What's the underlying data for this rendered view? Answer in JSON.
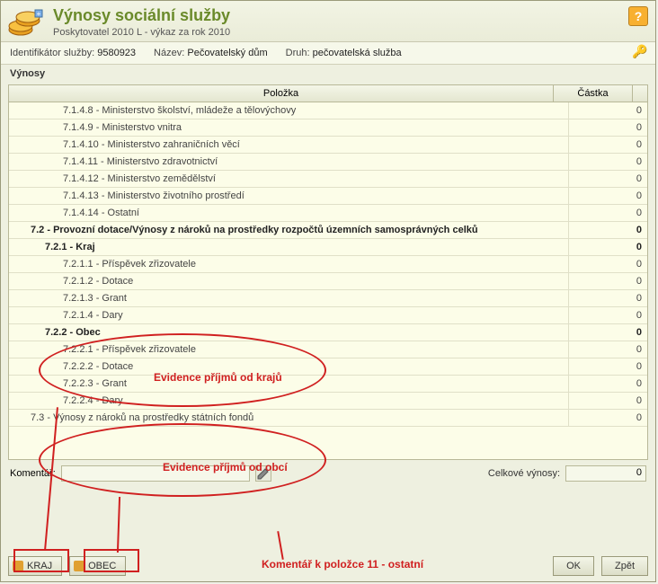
{
  "header": {
    "title": "Výnosy sociální služby",
    "subtitle": "Poskytovatel 2010 L - výkaz za rok 2010"
  },
  "info": {
    "id_label": "Identifikátor služby:",
    "id_value": "9580923",
    "name_label": "Název:",
    "name_value": "Pečovatelský dům",
    "type_label": "Druh:",
    "type_value": "pečovatelská služba"
  },
  "section": "Výnosy",
  "columns": {
    "name": "Položka",
    "amount": "Částka"
  },
  "rows": [
    {
      "label": "7.1.4.8 - Ministerstvo školství, mládeže a tělovýchovy",
      "amt": "0",
      "indent": 3
    },
    {
      "label": "7.1.4.9 - Ministerstvo vnitra",
      "amt": "0",
      "indent": 3
    },
    {
      "label": "7.1.4.10 - Ministerstvo zahraničních věcí",
      "amt": "0",
      "indent": 3
    },
    {
      "label": "7.1.4.11 - Ministerstvo zdravotnictví",
      "amt": "0",
      "indent": 3
    },
    {
      "label": "7.1.4.12 - Ministerstvo zemědělství",
      "amt": "0",
      "indent": 3
    },
    {
      "label": "7.1.4.13 - Ministerstvo životního prostředí",
      "amt": "0",
      "indent": 3
    },
    {
      "label": "7.1.4.14 - Ostatní",
      "amt": "0",
      "indent": 3
    },
    {
      "label": "7.2 - Provozní dotace/Výnosy z nároků na prostředky rozpočtů územních samosprávných celků",
      "amt": "0",
      "indent": 1,
      "bold": true
    },
    {
      "label": "7.2.1 - Kraj",
      "amt": "0",
      "indent": 2,
      "bold": true
    },
    {
      "label": "7.2.1.1 - Příspěvek zřizovatele",
      "amt": "0",
      "indent": 3
    },
    {
      "label": "7.2.1.2 - Dotace",
      "amt": "0",
      "indent": 3
    },
    {
      "label": "7.2.1.3 - Grant",
      "amt": "0",
      "indent": 3
    },
    {
      "label": "7.2.1.4 - Dary",
      "amt": "0",
      "indent": 3
    },
    {
      "label": "7.2.2 - Obec",
      "amt": "0",
      "indent": 2,
      "bold": true
    },
    {
      "label": "7.2.2.1 - Příspěvek zřizovatele",
      "amt": "0",
      "indent": 3
    },
    {
      "label": "7.2.2.2 - Dotace",
      "amt": "0",
      "indent": 3
    },
    {
      "label": "7.2.2.3 - Grant",
      "amt": "0",
      "indent": 3
    },
    {
      "label": "7.2.2.4 - Dary",
      "amt": "0",
      "indent": 3
    },
    {
      "label": "7.3 - Výnosy z nároků na prostředky státních fondů",
      "amt": "0",
      "indent": 1
    }
  ],
  "bottom": {
    "comment_label": "Komentář:",
    "total_label": "Celkové výnosy:",
    "total_value": "0"
  },
  "buttons": {
    "kraj": "KRAJ",
    "obec": "OBEC",
    "ok": "OK",
    "back": "Zpět"
  },
  "annotations": {
    "kraj": "Evidence příjmů od krajů",
    "obec": "Evidence příjmů od obcí",
    "comment": "Komentář k položce 11 - ostatní"
  }
}
